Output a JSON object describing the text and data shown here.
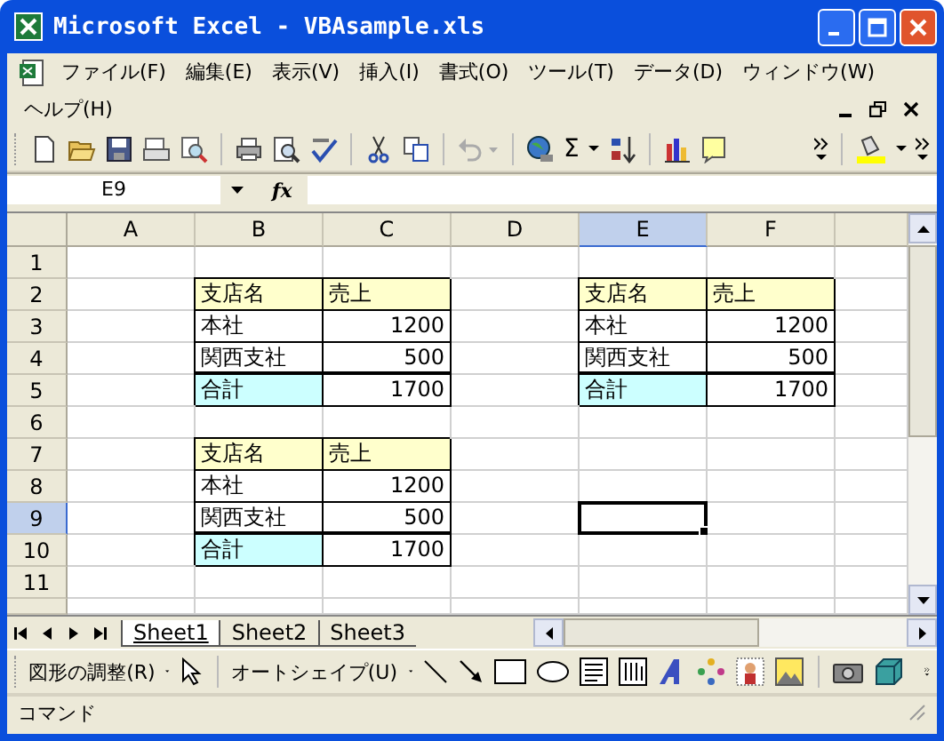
{
  "window": {
    "title": "Microsoft Excel - VBAsample.xls"
  },
  "menu_bar": {
    "items": [
      "ファイル(F)",
      "編集(E)",
      "表示(V)",
      "挿入(I)",
      "書式(O)",
      "ツール(T)",
      "データ(D)",
      "ウィンドウ(W)",
      "ヘルプ(H)"
    ]
  },
  "toolbar": {
    "autosum_label": "Σ"
  },
  "formula_bar": {
    "name_box": "E9",
    "function_label": "fx"
  },
  "sheet": {
    "columns": [
      {
        "label": "A",
        "selected": false
      },
      {
        "label": "B",
        "selected": false
      },
      {
        "label": "C",
        "selected": false
      },
      {
        "label": "D",
        "selected": false
      },
      {
        "label": "E",
        "selected": true
      },
      {
        "label": "F",
        "selected": false
      }
    ],
    "rows": [
      {
        "label": "1",
        "selected": false,
        "cells": [
          null,
          null,
          null,
          null,
          null,
          null
        ]
      },
      {
        "label": "2",
        "selected": false,
        "cells": [
          null,
          {
            "text": "支店名",
            "kind": "header"
          },
          {
            "text": "売上",
            "kind": "header"
          },
          null,
          {
            "text": "支店名",
            "kind": "header"
          },
          {
            "text": "売上",
            "kind": "header"
          }
        ]
      },
      {
        "label": "3",
        "selected": false,
        "cells": [
          null,
          {
            "text": "本社",
            "kind": "label"
          },
          {
            "text": "1200",
            "kind": "number"
          },
          null,
          {
            "text": "本社",
            "kind": "label"
          },
          {
            "text": "1200",
            "kind": "number"
          }
        ]
      },
      {
        "label": "4",
        "selected": false,
        "cells": [
          null,
          {
            "text": "関西支社",
            "kind": "label"
          },
          {
            "text": "500",
            "kind": "number"
          },
          null,
          {
            "text": "関西支社",
            "kind": "label"
          },
          {
            "text": "500",
            "kind": "number"
          }
        ]
      },
      {
        "label": "5",
        "selected": false,
        "cells": [
          null,
          {
            "text": "合計",
            "kind": "total"
          },
          {
            "text": "1700",
            "kind": "total_number"
          },
          null,
          {
            "text": "合計",
            "kind": "total"
          },
          {
            "text": "1700",
            "kind": "total_number"
          }
        ]
      },
      {
        "label": "6",
        "selected": false,
        "cells": [
          null,
          null,
          null,
          null,
          null,
          null
        ]
      },
      {
        "label": "7",
        "selected": false,
        "cells": [
          null,
          {
            "text": "支店名",
            "kind": "header"
          },
          {
            "text": "売上",
            "kind": "header"
          },
          null,
          null,
          null
        ]
      },
      {
        "label": "8",
        "selected": false,
        "cells": [
          null,
          {
            "text": "本社",
            "kind": "label"
          },
          {
            "text": "1200",
            "kind": "number"
          },
          null,
          null,
          null
        ]
      },
      {
        "label": "9",
        "selected": true,
        "cells": [
          null,
          {
            "text": "関西支社",
            "kind": "label"
          },
          {
            "text": "500",
            "kind": "number"
          },
          null,
          null,
          null
        ]
      },
      {
        "label": "10",
        "selected": false,
        "cells": [
          null,
          {
            "text": "合計",
            "kind": "total"
          },
          {
            "text": "1700",
            "kind": "total_number"
          },
          null,
          null,
          null
        ]
      },
      {
        "label": "11",
        "selected": false,
        "cells": [
          null,
          null,
          null,
          null,
          null,
          null
        ]
      }
    ]
  },
  "sheet_tabs": [
    {
      "label": "Sheet1",
      "selected": true
    },
    {
      "label": "Sheet2",
      "selected": false
    },
    {
      "label": "Sheet3",
      "selected": false
    }
  ],
  "drawing_toolbar": {
    "draw_menu": "図形の調整(R)",
    "autoshape_menu": "オートシェイプ(U)"
  },
  "status_bar": {
    "text": "コマンド"
  }
}
